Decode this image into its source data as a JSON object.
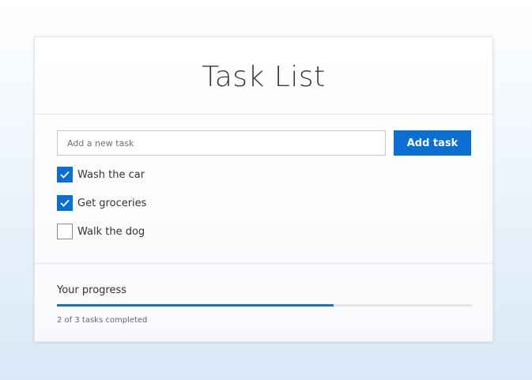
{
  "header": {
    "title": "Task List"
  },
  "new_task": {
    "placeholder": "Add a new task",
    "value": "",
    "add_button_label": "Add task"
  },
  "tasks": [
    {
      "label": "Wash the car",
      "completed": true
    },
    {
      "label": "Get groceries",
      "completed": true
    },
    {
      "label": "Walk the dog",
      "completed": false
    }
  ],
  "progress": {
    "title": "Your progress",
    "completed": 2,
    "total": 3,
    "fraction": 0.6667,
    "summary": "2 of 3 tasks completed"
  },
  "colors": {
    "accent": "#0a6fd1",
    "progress_fill": "#1a73b5"
  }
}
